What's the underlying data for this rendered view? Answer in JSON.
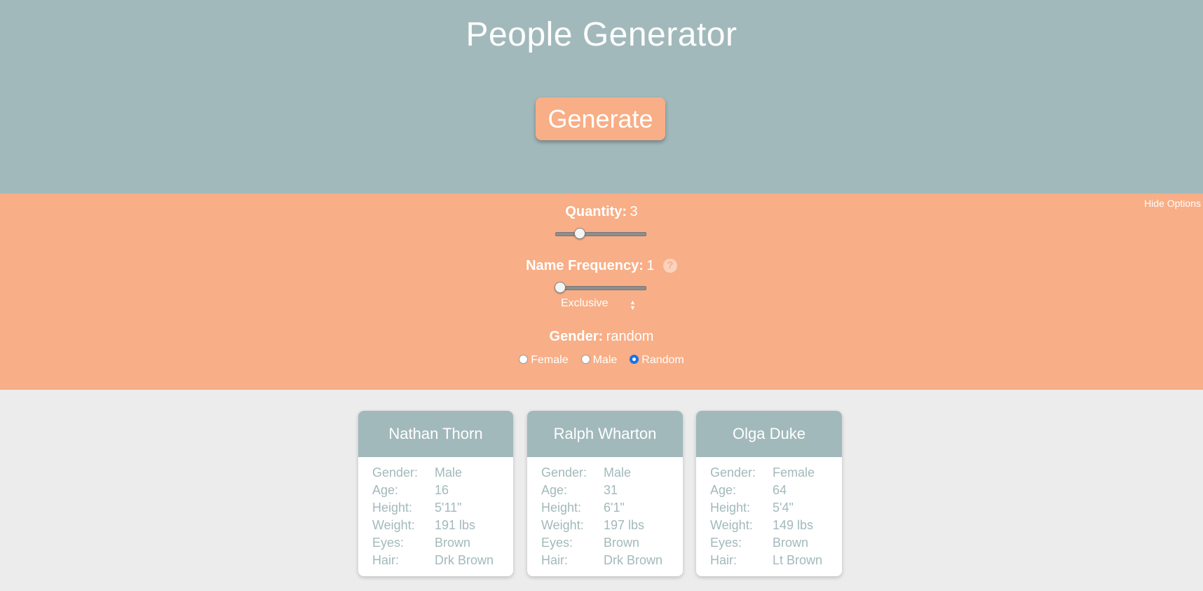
{
  "header": {
    "title": "People Generator",
    "generate_label": "Generate"
  },
  "options": {
    "hide_label": "Hide Options",
    "quantity": {
      "label": "Quantity:",
      "value": "3",
      "slider_fraction": 0.25
    },
    "name_frequency": {
      "label": "Name Frequency:",
      "value": "1",
      "help_icon": "?",
      "slider_fraction": 0.0,
      "select_value": "Exclusive"
    },
    "gender": {
      "label": "Gender:",
      "value": "random",
      "options": [
        {
          "label": "Female",
          "checked": false
        },
        {
          "label": "Male",
          "checked": false
        },
        {
          "label": "Random",
          "checked": true
        }
      ]
    }
  },
  "people": [
    {
      "name": "Nathan Thorn",
      "attrs": [
        {
          "k": "Gender:",
          "v": "Male"
        },
        {
          "k": "Age:",
          "v": "16"
        },
        {
          "k": "Height:",
          "v": "5'11\""
        },
        {
          "k": "Weight:",
          "v": "191 lbs"
        },
        {
          "k": "Eyes:",
          "v": "Brown"
        },
        {
          "k": "Hair:",
          "v": "Drk Brown"
        }
      ]
    },
    {
      "name": "Ralph Wharton",
      "attrs": [
        {
          "k": "Gender:",
          "v": "Male"
        },
        {
          "k": "Age:",
          "v": "31"
        },
        {
          "k": "Height:",
          "v": "6'1\""
        },
        {
          "k": "Weight:",
          "v": "197 lbs"
        },
        {
          "k": "Eyes:",
          "v": "Brown"
        },
        {
          "k": "Hair:",
          "v": "Drk Brown"
        }
      ]
    },
    {
      "name": "Olga Duke",
      "attrs": [
        {
          "k": "Gender:",
          "v": "Female"
        },
        {
          "k": "Age:",
          "v": "64"
        },
        {
          "k": "Height:",
          "v": "5'4\""
        },
        {
          "k": "Weight:",
          "v": "149 lbs"
        },
        {
          "k": "Eyes:",
          "v": "Brown"
        },
        {
          "k": "Hair:",
          "v": "Lt Brown"
        }
      ]
    }
  ],
  "colors": {
    "header_bg": "#a2b9bb",
    "accent": "#f8ae86",
    "page_bg": "#ececec",
    "radio_selected": "#1a73e8"
  }
}
